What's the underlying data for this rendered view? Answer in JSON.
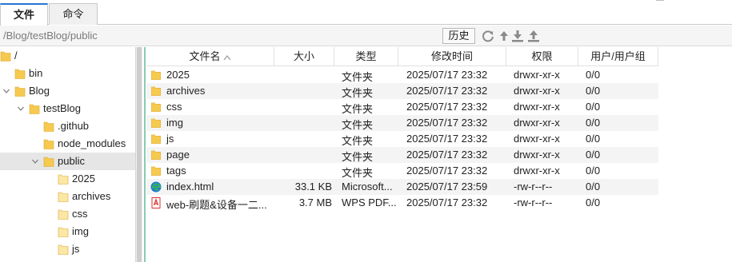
{
  "tabs": [
    {
      "label": "文件",
      "active": true
    },
    {
      "label": "命令",
      "active": false
    }
  ],
  "pathbar": {
    "path": "/Blog/testBlog/public",
    "history_label": "历史"
  },
  "toolbar_icons": [
    "refresh-icon",
    "upload-arrow-icon",
    "download-icon",
    "upload-icon"
  ],
  "tree": [
    {
      "label": "/",
      "level": 0,
      "chevron": "none",
      "selected": false
    },
    {
      "label": "bin",
      "level": 1,
      "chevron": "none",
      "selected": false
    },
    {
      "label": "Blog",
      "level": 1,
      "chevron": "down",
      "selected": false
    },
    {
      "label": "testBlog",
      "level": 2,
      "chevron": "down",
      "selected": false
    },
    {
      "label": ".github",
      "level": 3,
      "chevron": "none",
      "selected": false
    },
    {
      "label": "node_modules",
      "level": 3,
      "chevron": "none",
      "selected": false
    },
    {
      "label": "public",
      "level": 3,
      "chevron": "down",
      "selected": true
    },
    {
      "label": "2025",
      "level": 4,
      "chevron": "none",
      "selected": false
    },
    {
      "label": "archives",
      "level": 4,
      "chevron": "none",
      "selected": false
    },
    {
      "label": "css",
      "level": 4,
      "chevron": "none",
      "selected": false
    },
    {
      "label": "img",
      "level": 4,
      "chevron": "none",
      "selected": false
    },
    {
      "label": "js",
      "level": 4,
      "chevron": "none",
      "selected": false
    }
  ],
  "columns": {
    "name": "文件名",
    "size": "大小",
    "type": "类型",
    "modified": "修改时间",
    "perm": "权限",
    "owner": "用户/用户组"
  },
  "files": [
    {
      "icon": "folder-icon",
      "name": "2025",
      "size": "",
      "type": "文件夹",
      "modified": "2025/07/17 23:32",
      "perm": "drwxr-xr-x",
      "owner": "0/0"
    },
    {
      "icon": "folder-icon",
      "name": "archives",
      "size": "",
      "type": "文件夹",
      "modified": "2025/07/17 23:32",
      "perm": "drwxr-xr-x",
      "owner": "0/0"
    },
    {
      "icon": "folder-icon",
      "name": "css",
      "size": "",
      "type": "文件夹",
      "modified": "2025/07/17 23:32",
      "perm": "drwxr-xr-x",
      "owner": "0/0"
    },
    {
      "icon": "folder-icon",
      "name": "img",
      "size": "",
      "type": "文件夹",
      "modified": "2025/07/17 23:32",
      "perm": "drwxr-xr-x",
      "owner": "0/0"
    },
    {
      "icon": "folder-icon",
      "name": "js",
      "size": "",
      "type": "文件夹",
      "modified": "2025/07/17 23:32",
      "perm": "drwxr-xr-x",
      "owner": "0/0"
    },
    {
      "icon": "folder-icon",
      "name": "page",
      "size": "",
      "type": "文件夹",
      "modified": "2025/07/17 23:32",
      "perm": "drwxr-xr-x",
      "owner": "0/0"
    },
    {
      "icon": "folder-icon",
      "name": "tags",
      "size": "",
      "type": "文件夹",
      "modified": "2025/07/17 23:32",
      "perm": "drwxr-xr-x",
      "owner": "0/0"
    },
    {
      "icon": "edge-html-icon",
      "name": "index.html",
      "size": "33.1 KB",
      "type": "Microsoft...",
      "modified": "2025/07/17 23:59",
      "perm": "-rw-r--r--",
      "owner": "0/0"
    },
    {
      "icon": "pdf-icon",
      "name": "web-刷题&设备一二...",
      "size": "3.7 MB",
      "type": "WPS PDF...",
      "modified": "2025/07/17 23:32",
      "perm": "-rw-r--r--",
      "owner": "0/0"
    }
  ],
  "colors": {
    "folder": "#f6c94f",
    "folder_light": "#fbe7a6",
    "tab_accent": "#2a74d6",
    "splitter": "#4caf8a",
    "pdf_red": "#d9332b",
    "edge_blue": "#1f7bd0",
    "edge_green": "#38b65a"
  }
}
